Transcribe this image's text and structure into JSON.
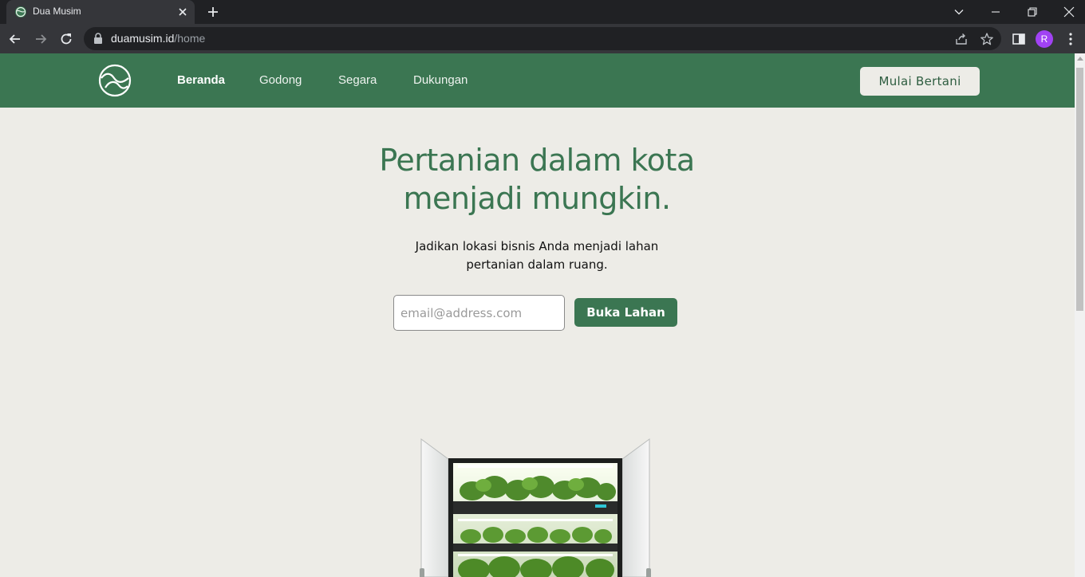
{
  "browser": {
    "tab_title": "Dua Musim",
    "url_host": "duamusim.id",
    "url_path": "/home",
    "profile_initial": "R",
    "icons": [
      "tab-favicon-icon",
      "close-icon",
      "plus-icon",
      "chevron-down-icon",
      "minimize-icon",
      "restore-icon",
      "window-close-icon",
      "back-arrow-icon",
      "forward-arrow-icon",
      "reload-icon",
      "lock-icon",
      "share-icon",
      "star-icon",
      "side-panel-icon",
      "kebab-menu-icon"
    ]
  },
  "site": {
    "nav": {
      "items": [
        {
          "label": "Beranda",
          "active": true
        },
        {
          "label": "Godong",
          "active": false
        },
        {
          "label": "Segara",
          "active": false
        },
        {
          "label": "Dukungan",
          "active": false
        }
      ],
      "cta_label": "Mulai Bertani"
    },
    "hero": {
      "title_line1": "Pertanian dalam kota",
      "title_line2": "menjadi mungkin.",
      "subtitle_line1": "Jadikan lokasi bisnis Anda menjadi lahan",
      "subtitle_line2": "pertanian dalam ruang.",
      "email_placeholder": "email@address.com",
      "button_label": "Buka Lahan"
    }
  },
  "colors": {
    "brand_green": "#3b7652",
    "page_bg": "#edece7",
    "chrome_dark": "#202124",
    "chrome_mid": "#35363a",
    "avatar": "#a142f4"
  }
}
